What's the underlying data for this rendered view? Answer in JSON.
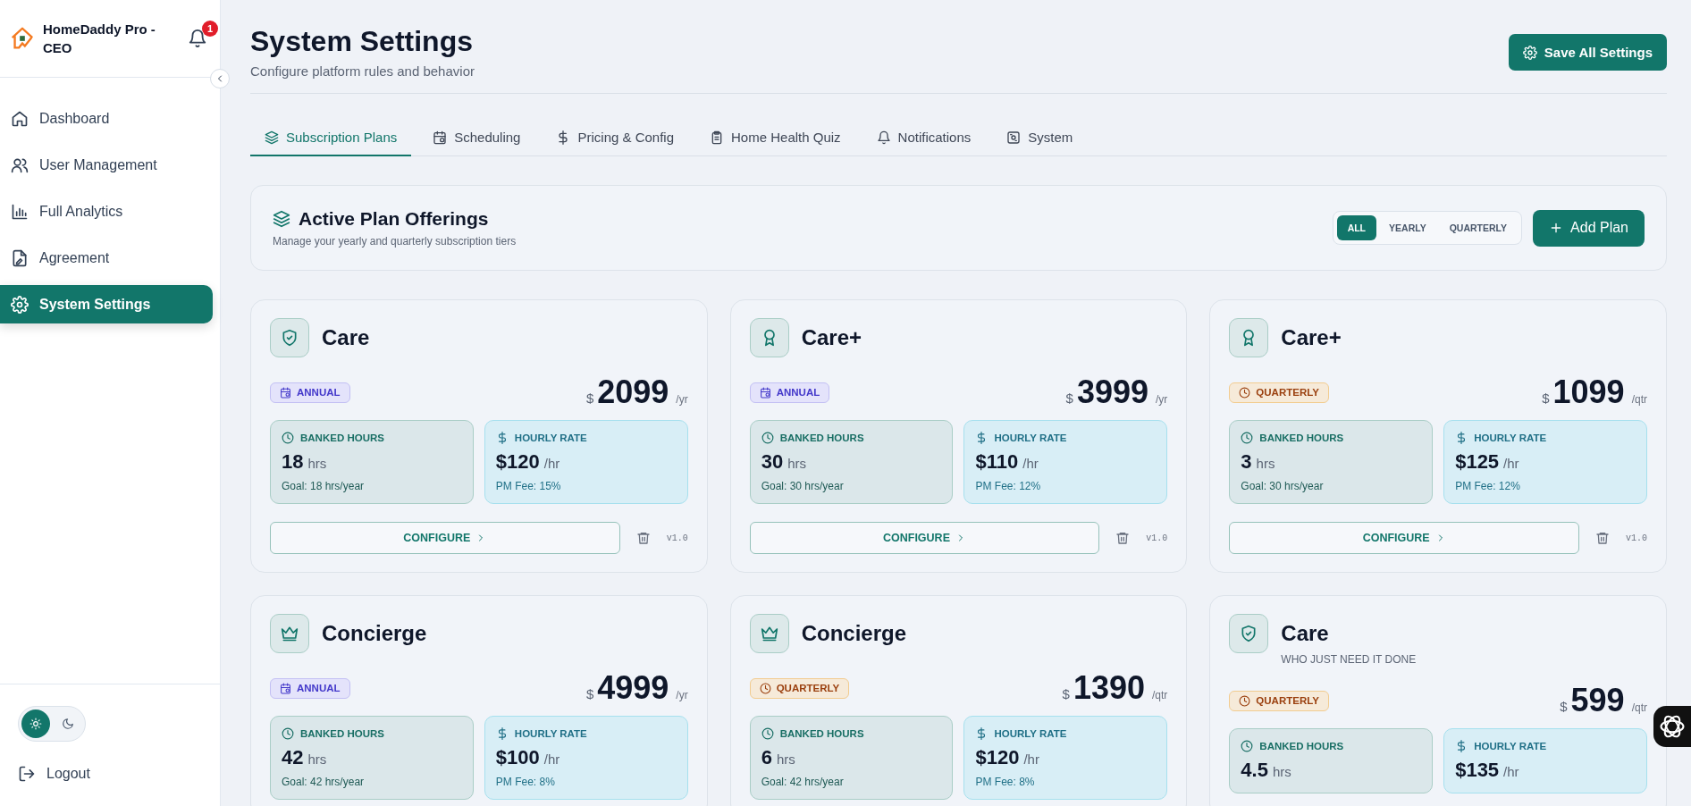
{
  "sidebar": {
    "brand": "HomeDaddy Pro - CEO",
    "notification_count": "1",
    "items": [
      {
        "label": "Dashboard",
        "selected": false
      },
      {
        "label": "User Management",
        "selected": false
      },
      {
        "label": "Full Analytics",
        "selected": false
      },
      {
        "label": "Agreement",
        "selected": false
      },
      {
        "label": "System Settings",
        "selected": true
      }
    ],
    "theme": [
      {
        "selected": true
      },
      {
        "selected": false
      }
    ],
    "logout": "Logout"
  },
  "header": {
    "title": "System Settings",
    "subtitle": "Configure platform rules and behavior",
    "save_button": "Save All Settings"
  },
  "tabs": [
    {
      "label": "Subscription Plans",
      "selected": true
    },
    {
      "label": "Scheduling",
      "selected": false
    },
    {
      "label": "Pricing & Config",
      "selected": false
    },
    {
      "label": "Home Health Quiz",
      "selected": false
    },
    {
      "label": "Notifications",
      "selected": false
    },
    {
      "label": "System",
      "selected": false
    }
  ],
  "offerings": {
    "title": "Active Plan Offerings",
    "subtitle": "Manage your yearly and quarterly subscription tiers",
    "filters": [
      {
        "label": "ALL",
        "selected": true
      },
      {
        "label": "YEARLY",
        "selected": false
      },
      {
        "label": "QUARTERLY",
        "selected": false
      }
    ],
    "add_button": "Add Plan"
  },
  "plans": [
    {
      "name": "Care",
      "kind": "annual",
      "badge": "ANNUAL",
      "currency": "$",
      "price": "2099",
      "unit": "/yr",
      "banked_label": "BANKED HOURS",
      "banked": "18",
      "banked_unit": "hrs",
      "goal": "Goal: 18 hrs/year",
      "rate_label": "HOURLY RATE",
      "rate": "$120",
      "rate_unit": "/hr",
      "fee": "PM Fee: 15%",
      "configure": "CONFIGURE",
      "version": "v1.0"
    },
    {
      "name": "Care+",
      "kind": "annual",
      "badge": "ANNUAL",
      "currency": "$",
      "price": "3999",
      "unit": "/yr",
      "banked_label": "BANKED HOURS",
      "banked": "30",
      "banked_unit": "hrs",
      "goal": "Goal: 30 hrs/year",
      "rate_label": "HOURLY RATE",
      "rate": "$110",
      "rate_unit": "/hr",
      "fee": "PM Fee: 12%",
      "configure": "CONFIGURE",
      "version": "v1.0"
    },
    {
      "name": "Care+",
      "kind": "quarterly",
      "badge": "QUARTERLY",
      "currency": "$",
      "price": "1099",
      "unit": "/qtr",
      "banked_label": "BANKED HOURS",
      "banked": "3",
      "banked_unit": "hrs",
      "goal": "Goal: 30 hrs/year",
      "rate_label": "HOURLY RATE",
      "rate": "$125",
      "rate_unit": "/hr",
      "fee": "PM Fee: 12%",
      "configure": "CONFIGURE",
      "version": "v1.0"
    },
    {
      "name": "Concierge",
      "kind": "annual",
      "badge": "ANNUAL",
      "currency": "$",
      "price": "4999",
      "unit": "/yr",
      "banked_label": "BANKED HOURS",
      "banked": "42",
      "banked_unit": "hrs",
      "goal": "Goal: 42 hrs/year",
      "rate_label": "HOURLY RATE",
      "rate": "$100",
      "rate_unit": "/hr",
      "fee": "PM Fee: 8%"
    },
    {
      "name": "Concierge",
      "kind": "quarterly",
      "badge": "QUARTERLY",
      "currency": "$",
      "price": "1390",
      "unit": "/qtr",
      "banked_label": "BANKED HOURS",
      "banked": "6",
      "banked_unit": "hrs",
      "goal": "Goal: 42 hrs/year",
      "rate_label": "HOURLY RATE",
      "rate": "$120",
      "rate_unit": "/hr",
      "fee": "PM Fee: 8%"
    },
    {
      "name": "Care",
      "subtitle": "WHO JUST NEED IT DONE",
      "kind": "quarterly",
      "badge": "QUARTERLY",
      "currency": "$",
      "price": "599",
      "unit": "/qtr",
      "banked_label": "BANKED HOURS",
      "banked": "4.5",
      "banked_unit": "hrs",
      "rate_label": "HOURLY RATE",
      "rate": "$135",
      "rate_unit": "/hr"
    }
  ]
}
